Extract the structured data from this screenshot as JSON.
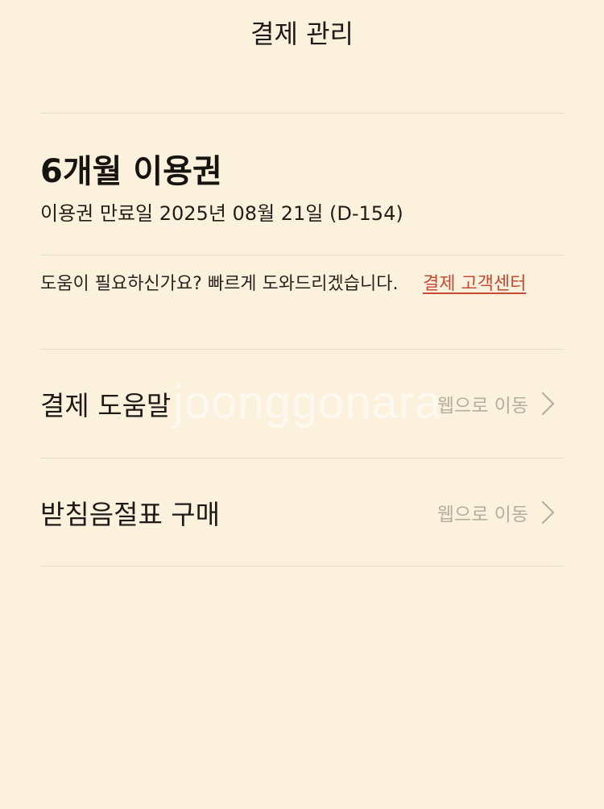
{
  "header": {
    "title": "결제 관리"
  },
  "plan": {
    "title": "6개월 이용권",
    "expiry_text": "이용권 만료일 2025년 08월 21일 (D-154)"
  },
  "help": {
    "text": "도움이 필요하신가요? 빠르게 도와드리겠습니다.",
    "link_label": "결제 고객센터"
  },
  "menu": {
    "items": [
      {
        "label": "결제 도움말",
        "hint": "웹으로 이동"
      },
      {
        "label": "받침음절표 구매",
        "hint": "웹으로 이동"
      }
    ]
  },
  "watermark": {
    "text": "joonggonara"
  },
  "colors": {
    "background": "#fbf1dd",
    "link": "#c84a32",
    "hint": "#b7ada1",
    "divider": "#e7dcc8"
  }
}
